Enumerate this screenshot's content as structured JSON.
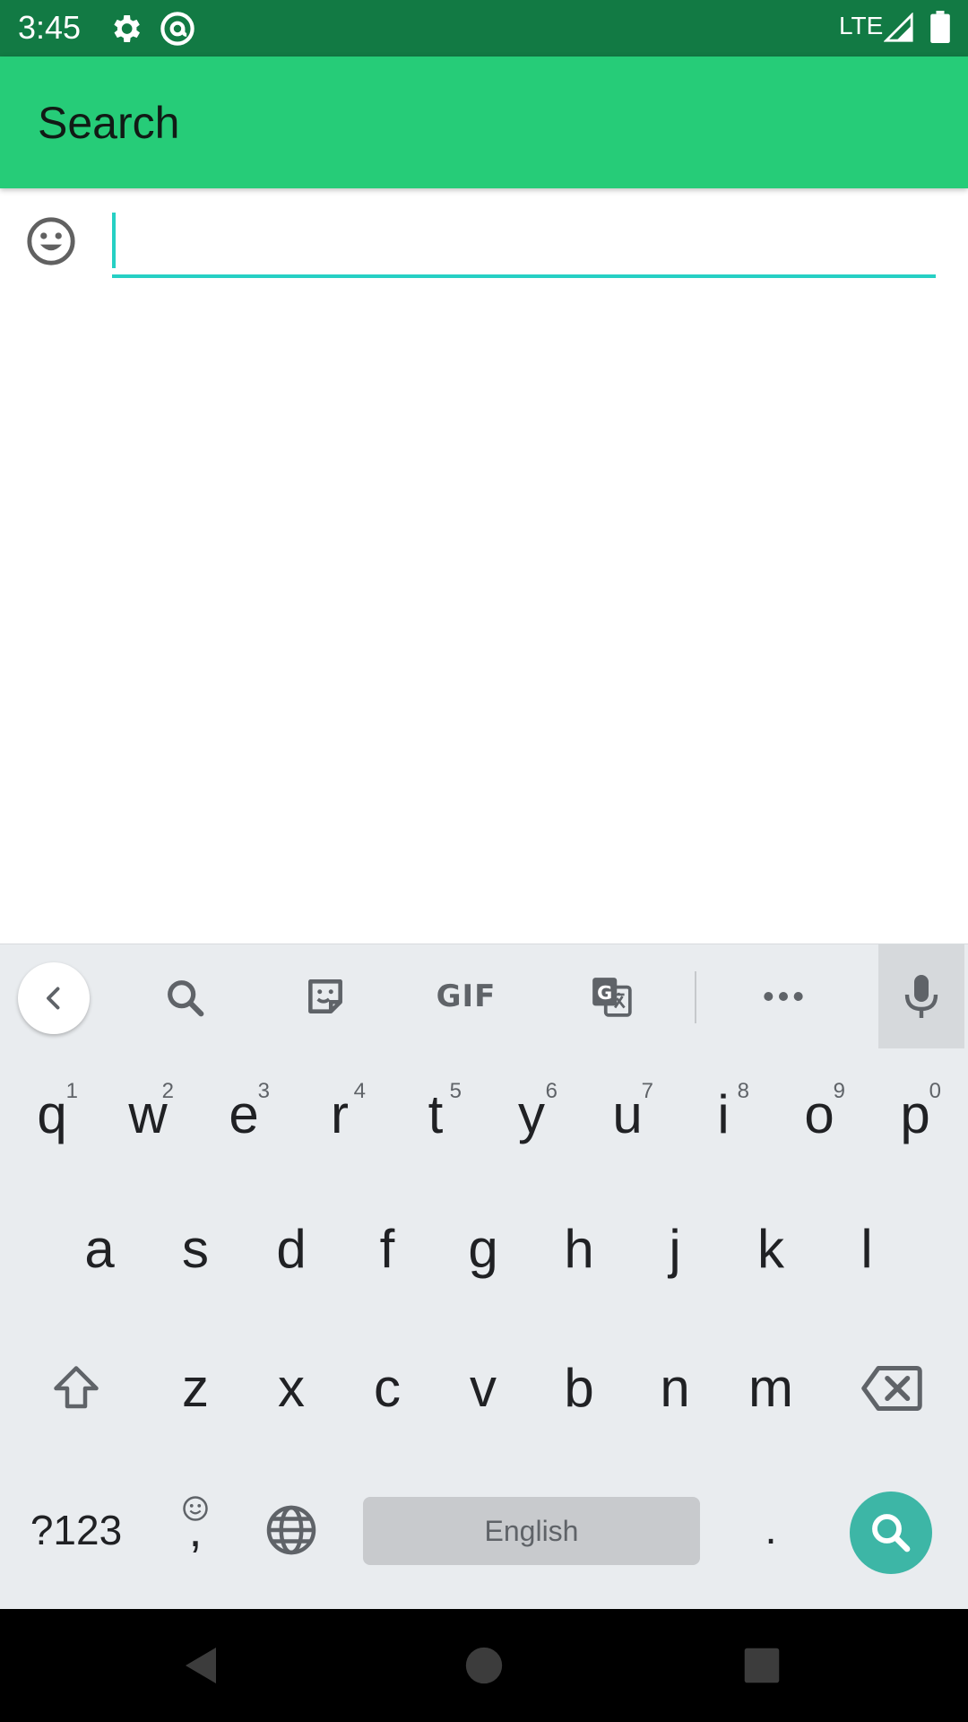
{
  "status_bar": {
    "time": "3:45",
    "network": "LTE"
  },
  "app_bar": {
    "title": "Search"
  },
  "search": {
    "value": "",
    "placeholder": ""
  },
  "keyboard": {
    "toolbar": {
      "gif_label": "GIF"
    },
    "row1": [
      {
        "key": "q",
        "hint": "1"
      },
      {
        "key": "w",
        "hint": "2"
      },
      {
        "key": "e",
        "hint": "3"
      },
      {
        "key": "r",
        "hint": "4"
      },
      {
        "key": "t",
        "hint": "5"
      },
      {
        "key": "y",
        "hint": "6"
      },
      {
        "key": "u",
        "hint": "7"
      },
      {
        "key": "i",
        "hint": "8"
      },
      {
        "key": "o",
        "hint": "9"
      },
      {
        "key": "p",
        "hint": "0"
      }
    ],
    "row2": [
      "a",
      "s",
      "d",
      "f",
      "g",
      "h",
      "j",
      "k",
      "l"
    ],
    "row3": [
      "z",
      "x",
      "c",
      "v",
      "b",
      "n",
      "m"
    ],
    "row4": {
      "symbols": "?123",
      "comma": ",",
      "spacebar": "English",
      "period": "."
    }
  },
  "colors": {
    "status_bar": "#127a44",
    "app_bar": "#26cc78",
    "accent": "#26d0c4",
    "keyboard_bg": "#e9ecef",
    "action_key": "#3db6a6"
  },
  "icons": {
    "status": [
      "gear-icon",
      "at-sign-icon",
      "cell-signal-icon",
      "battery-icon"
    ],
    "toolbar": [
      "chevron-left-icon",
      "search-icon",
      "sticker-icon",
      "translate-icon",
      "more-horiz-icon",
      "microphone-icon"
    ],
    "keyboard": [
      "shift-icon",
      "backspace-icon",
      "smiley-icon",
      "globe-icon",
      "search-icon"
    ],
    "nav": [
      "back-triangle-icon",
      "home-circle-icon",
      "recents-square-icon"
    ]
  }
}
